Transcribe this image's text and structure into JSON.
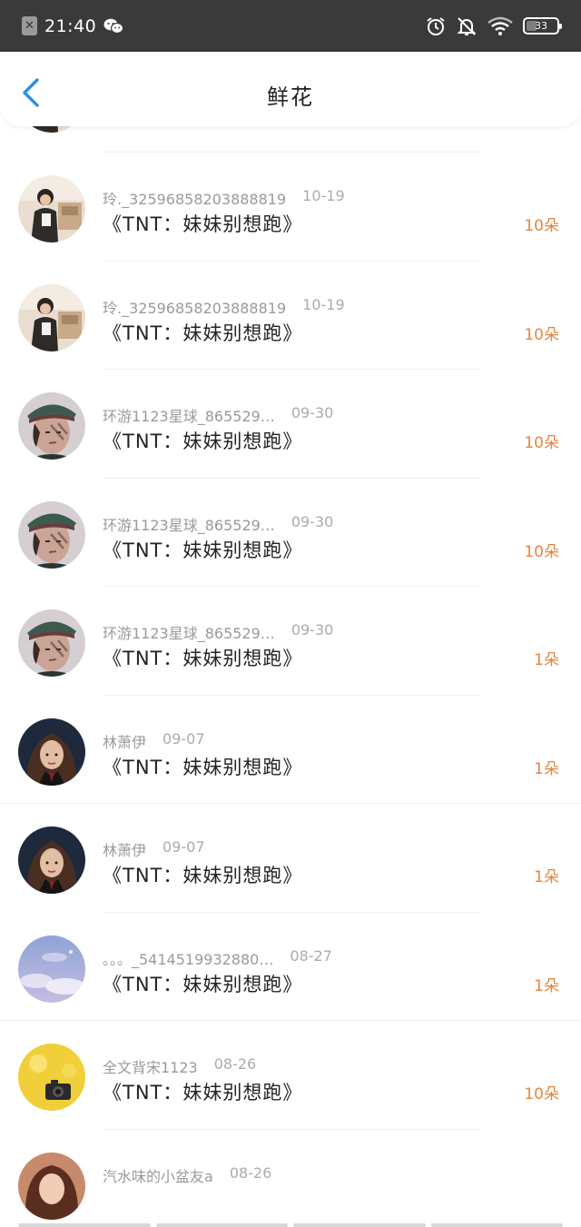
{
  "status_bar": {
    "time": "21:40",
    "battery": "33",
    "battery_level": 0.33,
    "icons": [
      "close-box-icon",
      "wechat-icon",
      "alarm-icon",
      "bell-off-icon",
      "wifi-icon",
      "battery-icon"
    ]
  },
  "nav": {
    "title": "鲜花",
    "back_icon": "chevron-left-icon",
    "accent": "#2b8fe0"
  },
  "colors": {
    "amount": "#e8843e",
    "meta": "#9a9a9a",
    "title": "#222222"
  },
  "items": [
    {
      "user": "玲._32596858203888819",
      "date": "10-19",
      "title": "《TNT：妹妹别想跑》",
      "amount": "10朵",
      "avatar": "avatar-girl-room"
    },
    {
      "user": "玲._32596858203888819",
      "date": "10-19",
      "title": "《TNT：妹妹别想跑》",
      "amount": "10朵",
      "avatar": "avatar-girl-room"
    },
    {
      "user": "玲._32596858203888819",
      "date": "10-19",
      "title": "《TNT：妹妹别想跑》",
      "amount": "10朵",
      "avatar": "avatar-girl-room"
    },
    {
      "user": "环游1123星球_865529…",
      "date": "09-30",
      "title": "《TNT：妹妹别想跑》",
      "amount": "10朵",
      "avatar": "avatar-boy-cap"
    },
    {
      "user": "环游1123星球_865529…",
      "date": "09-30",
      "title": "《TNT：妹妹别想跑》",
      "amount": "10朵",
      "avatar": "avatar-boy-cap"
    },
    {
      "user": "环游1123星球_865529…",
      "date": "09-30",
      "title": "《TNT：妹妹别想跑》",
      "amount": "1朵",
      "avatar": "avatar-boy-cap"
    },
    {
      "user": "林萧伊",
      "date": "09-07",
      "title": "《TNT：妹妹别想跑》",
      "amount": "1朵",
      "avatar": "avatar-dark-hair-girl"
    },
    {
      "user": "林萧伊",
      "date": "09-07",
      "title": "《TNT：妹妹别想跑》",
      "amount": "1朵",
      "avatar": "avatar-dark-hair-girl"
    },
    {
      "user": "。。。_5414519932880…",
      "date": "08-27",
      "title": "《TNT：妹妹别想跑》",
      "amount": "1朵",
      "avatar": "avatar-sky-clouds"
    },
    {
      "user": "全文背宋1123",
      "date": "08-26",
      "title": "《TNT：妹妹别想跑》",
      "amount": "10朵",
      "avatar": "avatar-yellow-camera"
    },
    {
      "user": "汽水味的小盆友a",
      "date": "08-26",
      "title": "",
      "amount": "",
      "avatar": "avatar-girl-portrait"
    }
  ]
}
